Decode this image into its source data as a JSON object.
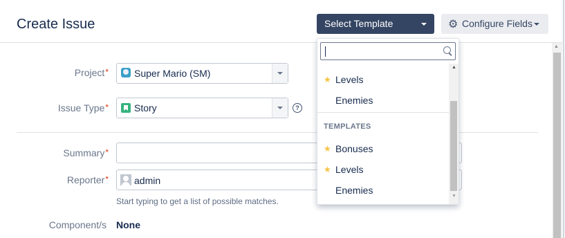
{
  "dialog": {
    "title": "Create Issue",
    "select_template_label": "Select Template",
    "configure_fields_label": "Configure Fields"
  },
  "form": {
    "project": {
      "label": "Project",
      "value": "Super Mario (SM)"
    },
    "issue_type": {
      "label": "Issue Type",
      "value": "Story"
    },
    "summary": {
      "label": "Summary",
      "value": ""
    },
    "reporter": {
      "label": "Reporter",
      "value": "admin",
      "hint": "Start typing to get a list of possible matches."
    },
    "component": {
      "label": "Component/s",
      "value": "None"
    }
  },
  "template_dropdown": {
    "search_value": "",
    "recent_items": [
      {
        "label": "Levels",
        "starred": true
      },
      {
        "label": "Enemies",
        "starred": false
      }
    ],
    "section_heading": "TEMPLATES",
    "template_items": [
      {
        "label": "Bonuses",
        "starred": true
      },
      {
        "label": "Levels",
        "starred": true
      },
      {
        "label": "Enemies",
        "starred": false
      }
    ]
  },
  "colors": {
    "primary_button": "#344563",
    "required": "#de350b",
    "star": "#f6c342",
    "story_icon": "#36b37e"
  }
}
